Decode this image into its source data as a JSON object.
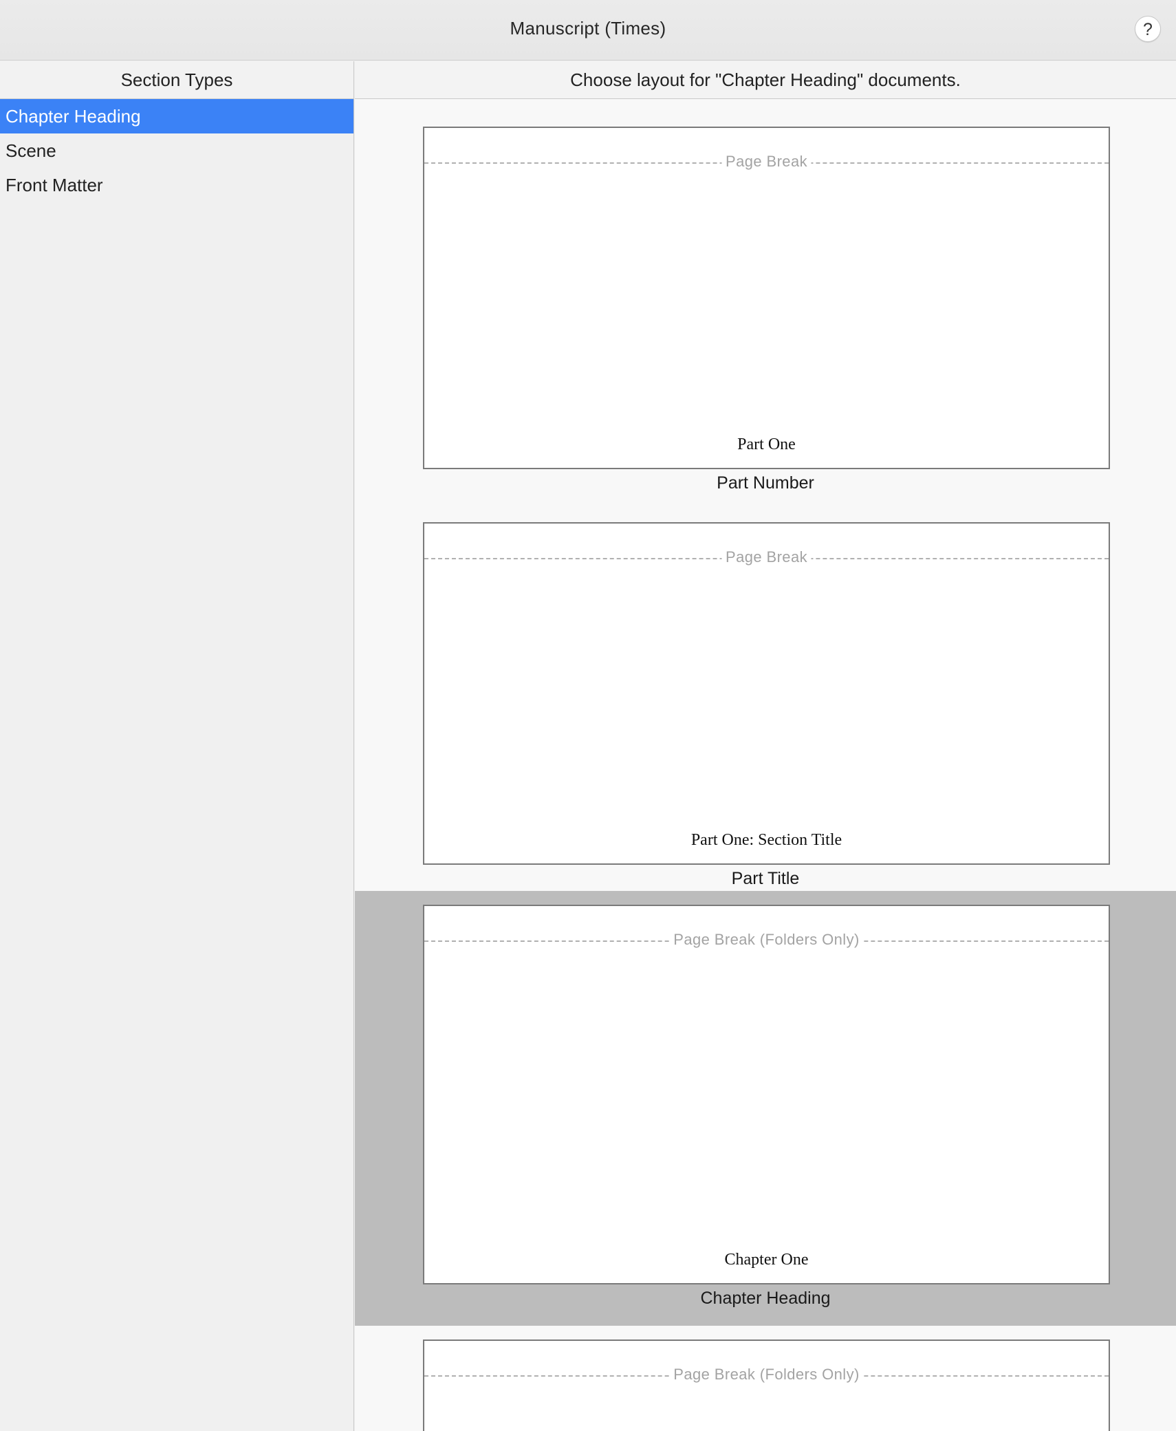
{
  "window": {
    "title": "Manuscript (Times)",
    "help_label": "?"
  },
  "sidebar": {
    "header": "Section Types",
    "items": [
      {
        "label": "Chapter Heading",
        "selected": true
      },
      {
        "label": "Scene",
        "selected": false
      },
      {
        "label": "Front Matter",
        "selected": false
      }
    ]
  },
  "main": {
    "header": "Choose layout for \"Chapter Heading\" documents.",
    "layouts": [
      {
        "page_break": "Page Break",
        "preview_text": "Part One",
        "caption": "Part Number",
        "selected": false
      },
      {
        "page_break": "Page Break",
        "preview_text": "Part One: Section Title",
        "caption": "Part Title",
        "selected": false
      },
      {
        "page_break": "Page Break (Folders Only)",
        "preview_text": "Chapter One",
        "caption": "Chapter Heading",
        "selected": true
      },
      {
        "page_break": "Page Break (Folders Only)",
        "preview_text": "",
        "caption": "",
        "selected": false
      }
    ]
  },
  "colors": {
    "selection_blue": "#3b82f6",
    "selected_layout_gray": "#bcbcbc"
  }
}
